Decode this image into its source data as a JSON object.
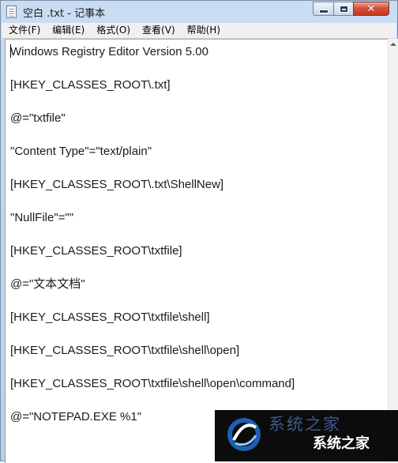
{
  "window": {
    "title": "空白 .txt - 记事本",
    "controls": {
      "minimize": "minimize",
      "maximize": "maximize",
      "close": "✕"
    }
  },
  "menu": [
    {
      "label": "文件(F)"
    },
    {
      "label": "编辑(E)"
    },
    {
      "label": "格式(O)"
    },
    {
      "label": "查看(V)"
    },
    {
      "label": "帮助(H)"
    }
  ],
  "document": {
    "lines": [
      "Windows Registry Editor Version 5.00",
      "",
      "[HKEY_CLASSES_ROOT\\.txt]",
      "",
      "@=\"txtfile\"",
      "",
      "\"Content Type\"=\"text/plain\"",
      "",
      "[HKEY_CLASSES_ROOT\\.txt\\ShellNew]",
      "",
      "\"NullFile\"=\"\"",
      "",
      "[HKEY_CLASSES_ROOT\\txtfile]",
      "",
      "@=\"文本文档\"",
      "",
      "[HKEY_CLASSES_ROOT\\txtfile\\shell]",
      "",
      "[HKEY_CLASSES_ROOT\\txtfile\\shell\\open]",
      "",
      "[HKEY_CLASSES_ROOT\\txtfile\\shell\\open\\command]",
      "",
      "@=\"NOTEPAD.EXE %1\""
    ]
  },
  "watermark": {
    "ghost_text": "系统之家",
    "text": "系统之家"
  },
  "colors": {
    "title_bar": "#c9dcf2",
    "close_button": "#c3371f",
    "menu_bar": "#f0f0f0",
    "text": "#1a1a1a",
    "watermark_bg": "#0c0c0c"
  }
}
